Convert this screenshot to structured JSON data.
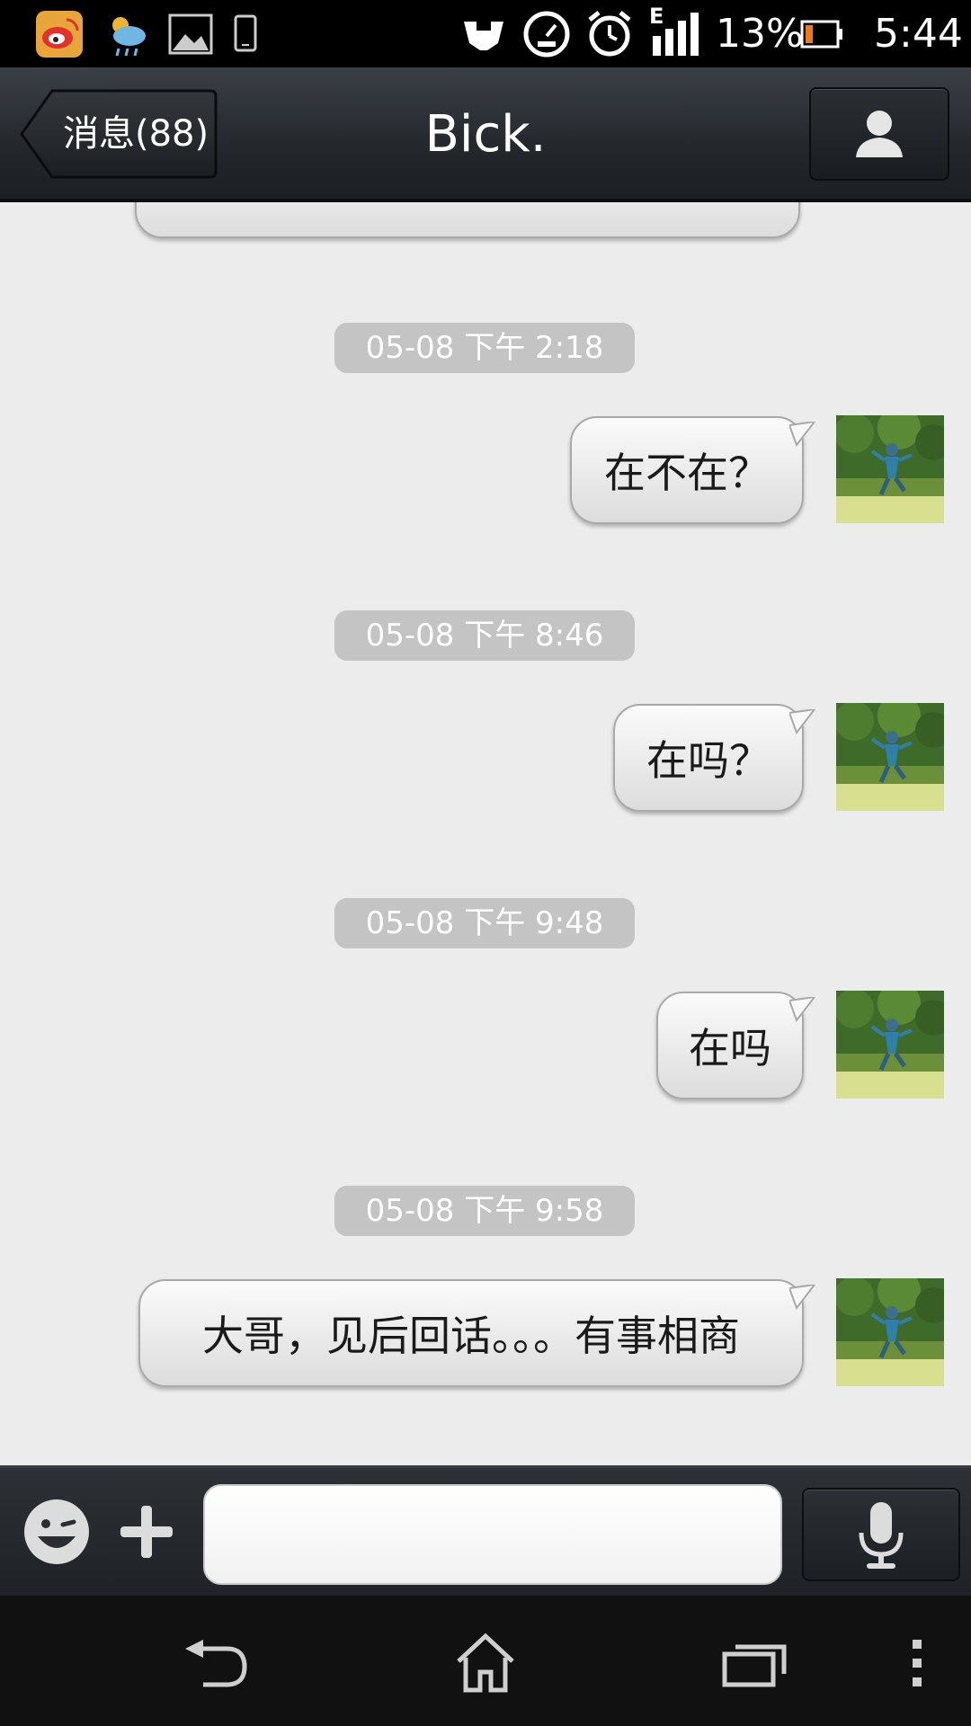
{
  "status_bar": {
    "icons": [
      "weibo-icon",
      "weather-icon",
      "gallery-icon",
      "phone-icon",
      "nfc-icon",
      "speedometer-icon",
      "alarm-icon",
      "signal-icon",
      "battery-icon"
    ],
    "network_type": "E",
    "battery_percent": "13%",
    "time": "5:44"
  },
  "header": {
    "back_label": "消息(88)",
    "title": "Bick.",
    "profile_icon": "person-icon"
  },
  "messages": [
    {
      "timestamp": "05-08 下午 2:18",
      "text": "在不在？",
      "side": "right"
    },
    {
      "timestamp": "05-08 下午 8:46",
      "text": "在吗？",
      "side": "right"
    },
    {
      "timestamp": "05-08 下午 9:48",
      "text": "在吗",
      "side": "right"
    },
    {
      "timestamp": "05-08 下午 9:58",
      "text": "大哥，见后回话。。。有事相商",
      "side": "right"
    }
  ],
  "input_bar": {
    "emoji_icon": "emoji-icon",
    "plus_icon": "plus-icon",
    "input_value": "",
    "mic_icon": "microphone-icon"
  },
  "nav_bar": {
    "icons": [
      "back-icon",
      "home-icon",
      "recent-apps-icon",
      "menu-icon"
    ]
  },
  "colors": {
    "chat_bg": "#ececec",
    "timestamp_bg": "#c4c4c4",
    "header_bg": "#24282d",
    "status_bar_bg": "#000000"
  }
}
